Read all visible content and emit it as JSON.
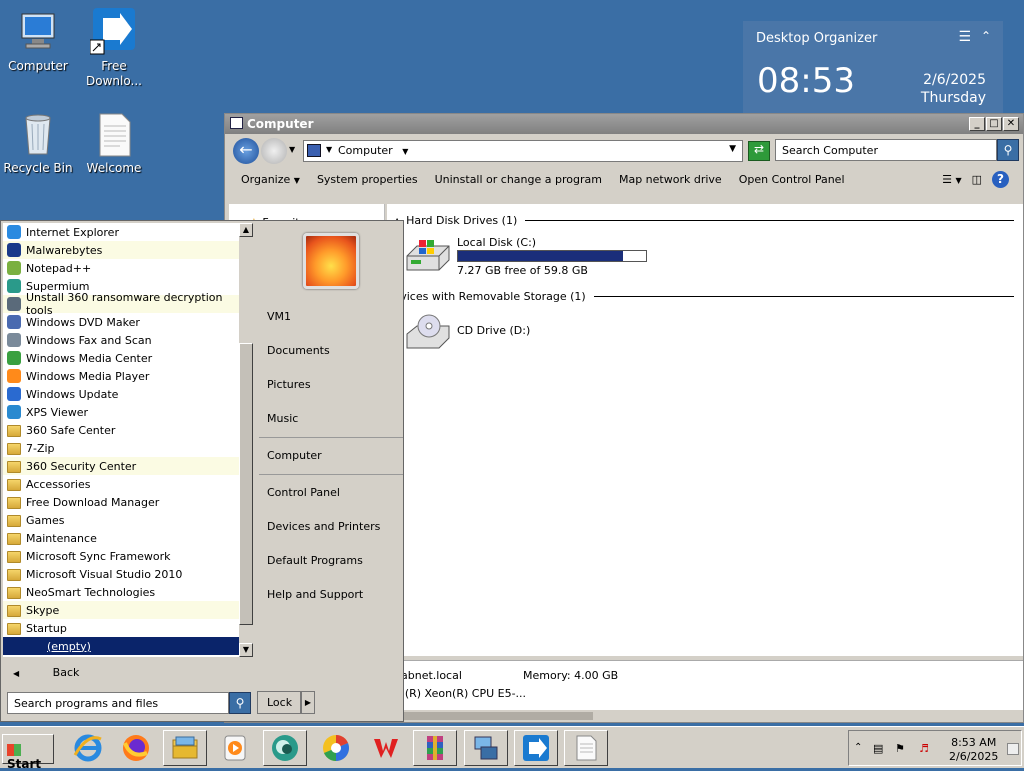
{
  "desktop_icons": [
    {
      "label": "Computer"
    },
    {
      "label": "Free Downlo..."
    },
    {
      "label": "Recycle Bin"
    },
    {
      "label": "Welcome"
    }
  ],
  "organizer": {
    "title": "Desktop Organizer",
    "time": "08:53",
    "date": "2/6/2025",
    "weekday": "Thursday"
  },
  "explorer": {
    "title": "Computer",
    "address": "Computer",
    "search_placeholder": "Search Computer",
    "commands": [
      "Organize",
      "System properties",
      "Uninstall or change a program",
      "Map network drive",
      "Open Control Panel"
    ],
    "nav_favorites": "Favorites",
    "groups": {
      "hdd": "Hard Disk Drives (1)",
      "removable": "Devices with Removable Storage (1)"
    },
    "drives": {
      "c_name": "Local Disk (C:)",
      "c_free": "7.27 GB free of 59.8 GB",
      "c_used_fraction": 0.878,
      "d_name": "CD Drive (D:)"
    },
    "details": {
      "domain": "abnet.local",
      "memory": "Memory: 4.00 GB",
      "cpu": "el(R) Xeon(R) CPU E5-..."
    }
  },
  "start_menu": {
    "programs": [
      {
        "label": "Internet Explorer",
        "icon": "ie-icon",
        "highlight": false
      },
      {
        "label": "Malwarebytes",
        "icon": "malwarebytes-icon",
        "highlight": true
      },
      {
        "label": "Notepad++",
        "icon": "notepadpp-icon",
        "highlight": false
      },
      {
        "label": "Supermium",
        "icon": "supermium-icon",
        "highlight": false
      },
      {
        "label": "Unstall 360 ransomware decryption tools",
        "icon": "tool-icon",
        "highlight": true
      },
      {
        "label": "Windows DVD Maker",
        "icon": "dvd-maker-icon",
        "highlight": false
      },
      {
        "label": "Windows Fax and Scan",
        "icon": "fax-icon",
        "highlight": false
      },
      {
        "label": "Windows Media Center",
        "icon": "media-center-icon",
        "highlight": false
      },
      {
        "label": "Windows Media Player",
        "icon": "media-player-icon",
        "highlight": false
      },
      {
        "label": "Windows Update",
        "icon": "update-icon",
        "highlight": false
      },
      {
        "label": "XPS Viewer",
        "icon": "xps-icon",
        "highlight": false
      },
      {
        "label": "360 Safe Center",
        "icon": "folder-icon",
        "highlight": false
      },
      {
        "label": "7-Zip",
        "icon": "folder-icon",
        "highlight": false
      },
      {
        "label": "360 Security Center",
        "icon": "folder-icon",
        "highlight": true
      },
      {
        "label": "Accessories",
        "icon": "folder-icon",
        "highlight": false
      },
      {
        "label": "Free Download Manager",
        "icon": "folder-icon",
        "highlight": false
      },
      {
        "label": "Games",
        "icon": "folder-icon",
        "highlight": false
      },
      {
        "label": "Maintenance",
        "icon": "folder-icon",
        "highlight": false
      },
      {
        "label": "Microsoft Sync Framework",
        "icon": "folder-icon",
        "highlight": false
      },
      {
        "label": "Microsoft Visual Studio 2010",
        "icon": "folder-icon",
        "highlight": false
      },
      {
        "label": "NeoSmart Technologies",
        "icon": "folder-icon",
        "highlight": false
      },
      {
        "label": "Skype",
        "icon": "folder-icon",
        "highlight": true
      },
      {
        "label": "Startup",
        "icon": "folder-icon",
        "highlight": false
      }
    ],
    "selected_item": "(empty)",
    "back_label": "Back",
    "search_placeholder": "Search programs and files",
    "right_links": {
      "user": "VM1",
      "documents": "Documents",
      "pictures": "Pictures",
      "music": "Music",
      "computer": "Computer",
      "control_panel": "Control Panel",
      "devices": "Devices and Printers",
      "default_programs": "Default Programs",
      "help": "Help and Support"
    },
    "lock_label": "Lock"
  },
  "taskbar": {
    "start_label": "Start",
    "apps": [
      "ie-icon",
      "firefox-icon",
      "explorer-icon",
      "media-player-icon",
      "supermium-icon",
      "chrome-like-icon",
      "wps-icon",
      "winrar-icon",
      "network-icon",
      "fdm-icon",
      "notepad-icon"
    ],
    "clock_time": "8:53 AM",
    "clock_date": "2/6/2025"
  },
  "colors": {
    "desktop": "#3a6ea5",
    "selection": "#0a246a",
    "highlight": "#fbfbe3"
  }
}
